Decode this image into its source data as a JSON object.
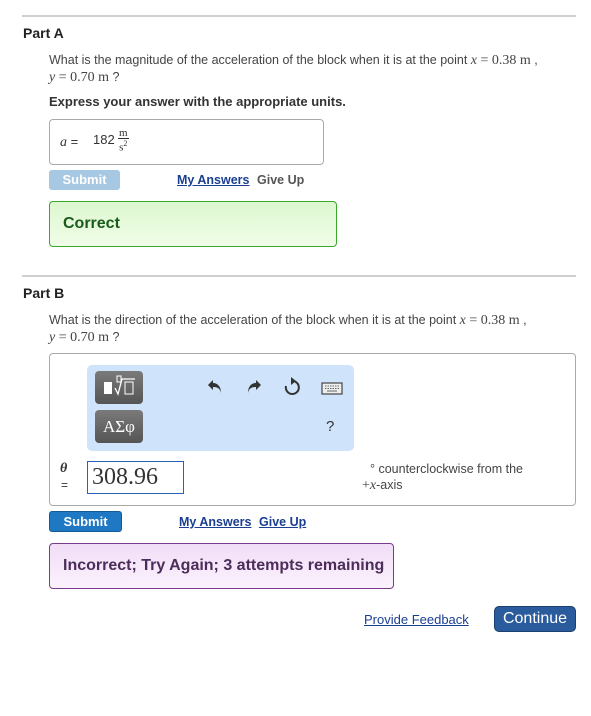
{
  "part_a": {
    "title": "Part A",
    "question_text": "What is the magnitude of the acceleration of the block when it is at the point",
    "x_var": "x",
    "x_value": "0.38",
    "y_var": "y",
    "y_value": "0.70",
    "unit": "m",
    "instruction": "Express your answer with the appropriate units.",
    "answer_label": "a =",
    "answer_value": "182",
    "answer_unit_num": "m",
    "answer_unit_den": "s2",
    "submit_label": "Submit",
    "my_answers_label": "My Answers",
    "give_up_label": "Give Up",
    "feedback": "Correct"
  },
  "part_b": {
    "title": "Part B",
    "question_text": "What is the direction of the acceleration of the block when it is at the point",
    "x_var": "x",
    "x_value": "0.38",
    "y_var": "y",
    "y_value": "0.70",
    "unit": "m",
    "toolbar": {
      "templates_icon": "templates-icon",
      "greek_label": "ΑΣφ",
      "undo_icon": "undo-icon",
      "redo_icon": "redo-icon",
      "reset_icon": "reset-icon",
      "keyboard_icon": "keyboard-icon",
      "help_label": "?"
    },
    "answer_var": "θ",
    "answer_eq": "=",
    "answer_value": "308.96",
    "unit_line1": "° counterclockwise from the",
    "unit_line2_sign": "+",
    "unit_line2_var": "x",
    "unit_line2_rest": "-axis",
    "submit_label": "Submit",
    "my_answers_label": "My Answers",
    "give_up_label": "Give Up",
    "feedback": "Incorrect; Try Again; 3 attempts remaining"
  },
  "footer": {
    "feedback_link": "Provide Feedback",
    "continue_label": "Continue"
  }
}
